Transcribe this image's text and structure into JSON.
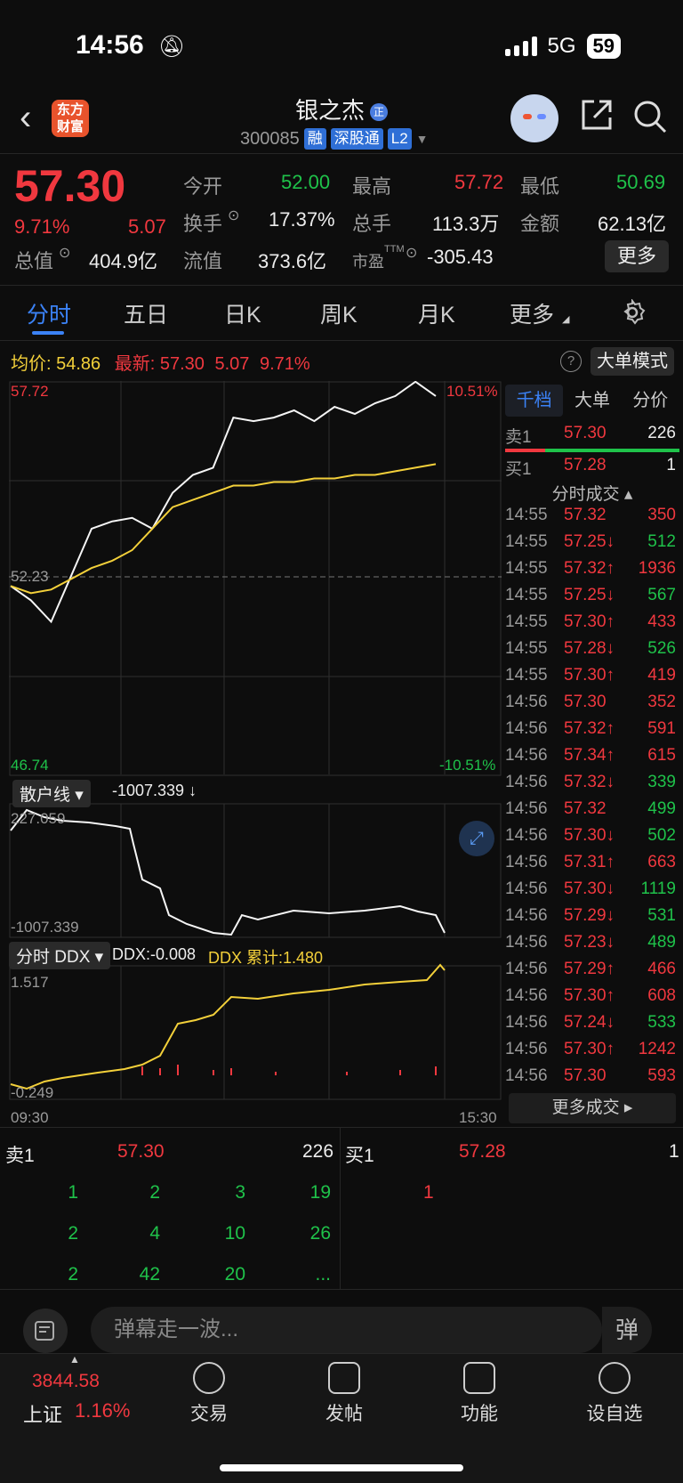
{
  "status": {
    "time": "14:56",
    "network": "5G",
    "battery": "59"
  },
  "header": {
    "logo": "东方财富",
    "stock_name": "银之杰",
    "name_badge": "正",
    "code": "300085",
    "tags": [
      "融",
      "深股通",
      "L2"
    ]
  },
  "quote": {
    "price": "57.30",
    "change_pct": "9.71%",
    "change": "5.07",
    "open_label": "今开",
    "open": "52.00",
    "high_label": "最高",
    "high": "57.72",
    "low_label": "最低",
    "low": "50.69",
    "turnover_label": "换手",
    "turnover": "17.37%",
    "volume_label": "总手",
    "volume": "113.3万",
    "amount_label": "金额",
    "amount": "62.13亿",
    "mktcap_label": "总值",
    "mktcap": "404.9亿",
    "float_label": "流值",
    "float_cap": "373.6亿",
    "pe_label": "市盈",
    "pe_sup": "TTM",
    "pe": "-305.43",
    "more": "更多"
  },
  "tabs": [
    "分时",
    "五日",
    "日K",
    "周K",
    "月K",
    "更多"
  ],
  "info": {
    "avg_label": "均价:",
    "avg": "54.86",
    "latest_label": "最新:",
    "latest": "57.30",
    "chg": "5.07",
    "pct": "9.71%",
    "mode": "大单模式"
  },
  "price_chart": {
    "top_left": "57.72",
    "top_right": "10.51%",
    "mid": "52.23",
    "bottom_left": "46.74",
    "bottom_right": "-10.51%"
  },
  "retail": {
    "label": "散户线",
    "value": "-1007.339 ↓",
    "top": "227.059",
    "bottom": "-1007.339"
  },
  "ddx": {
    "label": "分时 DDX",
    "ddx_text": "DDX:-0.008",
    "cum_text": "DDX 累计:1.480",
    "top": "1.517",
    "bottom": "-0.249"
  },
  "time_axis": {
    "start": "09:30",
    "end": "15:30"
  },
  "chart_data": {
    "type": "line",
    "x_range": [
      "09:30",
      "15:00"
    ],
    "ylim": [
      46.74,
      57.72
    ],
    "series": [
      {
        "values": [
          52.0,
          51.6,
          51.0,
          52.3,
          53.6,
          53.8,
          53.9,
          53.6,
          54.6,
          55.1,
          55.3,
          56.7,
          56.6,
          56.7,
          56.9,
          56.6,
          57.0,
          56.8,
          57.1,
          57.3,
          57.7,
          57.3
        ]
      },
      {
        "values": [
          52.0,
          51.8,
          51.9,
          52.2,
          52.5,
          52.7,
          53.0,
          53.6,
          54.2,
          54.4,
          54.6,
          54.8,
          54.8,
          54.9,
          54.9,
          55.0,
          55.0,
          55.1,
          55.1,
          55.2,
          55.3,
          55.4
        ]
      }
    ]
  },
  "right_panel": {
    "tabs": [
      "千档",
      "大单",
      "分价"
    ],
    "sell1": {
      "label": "卖1",
      "price": "57.30",
      "vol": "226"
    },
    "buy1": {
      "label": "买1",
      "price": "57.28",
      "vol": "1"
    },
    "ticks_title": "分时成交",
    "ticks": [
      {
        "t": "14:55",
        "p": "57.32",
        "v": "350",
        "dir": "",
        "vc": "red"
      },
      {
        "t": "14:55",
        "p": "57.25↓",
        "v": "512",
        "dir": "down",
        "vc": "green"
      },
      {
        "t": "14:55",
        "p": "57.32↑",
        "v": "1936",
        "dir": "up",
        "vc": "red"
      },
      {
        "t": "14:55",
        "p": "57.25↓",
        "v": "567",
        "dir": "down",
        "vc": "green"
      },
      {
        "t": "14:55",
        "p": "57.30↑",
        "v": "433",
        "dir": "up",
        "vc": "red"
      },
      {
        "t": "14:55",
        "p": "57.28↓",
        "v": "526",
        "dir": "down",
        "vc": "green"
      },
      {
        "t": "14:55",
        "p": "57.30↑",
        "v": "419",
        "dir": "up",
        "vc": "red"
      },
      {
        "t": "14:56",
        "p": "57.30",
        "v": "352",
        "dir": "",
        "vc": "red"
      },
      {
        "t": "14:56",
        "p": "57.32↑",
        "v": "591",
        "dir": "up",
        "vc": "red"
      },
      {
        "t": "14:56",
        "p": "57.34↑",
        "v": "615",
        "dir": "up",
        "vc": "red"
      },
      {
        "t": "14:56",
        "p": "57.32↓",
        "v": "339",
        "dir": "down",
        "vc": "green"
      },
      {
        "t": "14:56",
        "p": "57.32",
        "v": "499",
        "dir": "",
        "vc": "green"
      },
      {
        "t": "14:56",
        "p": "57.30↓",
        "v": "502",
        "dir": "down",
        "vc": "green"
      },
      {
        "t": "14:56",
        "p": "57.31↑",
        "v": "663",
        "dir": "up",
        "vc": "red"
      },
      {
        "t": "14:56",
        "p": "57.30↓",
        "v": "1119",
        "dir": "down",
        "vc": "green"
      },
      {
        "t": "14:56",
        "p": "57.29↓",
        "v": "531",
        "dir": "down",
        "vc": "green"
      },
      {
        "t": "14:56",
        "p": "57.23↓",
        "v": "489",
        "dir": "down",
        "vc": "green"
      },
      {
        "t": "14:56",
        "p": "57.29↑",
        "v": "466",
        "dir": "up",
        "vc": "red"
      },
      {
        "t": "14:56",
        "p": "57.30↑",
        "v": "608",
        "dir": "up",
        "vc": "red"
      },
      {
        "t": "14:56",
        "p": "57.24↓",
        "v": "533",
        "dir": "down",
        "vc": "green"
      },
      {
        "t": "14:56",
        "p": "57.30↑",
        "v": "1242",
        "dir": "up",
        "vc": "red"
      },
      {
        "t": "14:56",
        "p": "57.30",
        "v": "593",
        "dir": "",
        "vc": "red"
      }
    ],
    "more_ticks": "更多成交"
  },
  "book": {
    "sell": {
      "label": "卖1",
      "price": "57.30",
      "vol": "226",
      "queue": [
        [
          "1",
          "2",
          "3",
          "19"
        ],
        [
          "2",
          "4",
          "10",
          "26"
        ],
        [
          "2",
          "42",
          "20",
          "..."
        ]
      ]
    },
    "buy": {
      "label": "买1",
      "price": "57.28",
      "vol": "1",
      "queue": [
        [
          "1"
        ]
      ]
    }
  },
  "danmu": {
    "placeholder": "弹幕走一波...",
    "btn": "弹"
  },
  "bottom": {
    "index_value": "3844.58",
    "index_name": "上证",
    "index_pct": "1.16%",
    "items": [
      "交易",
      "发帖",
      "功能",
      "设自选"
    ]
  }
}
